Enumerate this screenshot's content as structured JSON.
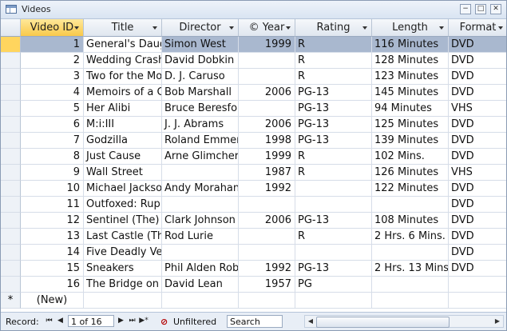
{
  "window": {
    "title": "Videos",
    "min_glyph": "−",
    "restore_glyph": "□",
    "close_glyph": "✕"
  },
  "columns": [
    {
      "label": "Video ID",
      "selected": true
    },
    {
      "label": "Title"
    },
    {
      "label": "Director"
    },
    {
      "label": "© Year"
    },
    {
      "label": "Rating"
    },
    {
      "label": "Length"
    },
    {
      "label": "Format"
    }
  ],
  "rows": [
    [
      "1",
      "General's Daug",
      "Simon West",
      "1999",
      "R",
      "116 Minutes",
      "DVD"
    ],
    [
      "2",
      "Wedding Crash",
      "David Dobkin",
      "",
      "R",
      "128 Minutes",
      "DVD"
    ],
    [
      "3",
      "Two for the Mo",
      "D. J. Caruso",
      "",
      "R",
      "123 Minutes",
      "DVD"
    ],
    [
      "4",
      "Memoirs of a G",
      "Bob Marshall",
      "2006",
      "PG-13",
      "145 Minutes",
      "DVD"
    ],
    [
      "5",
      "Her Alibi",
      "Bruce Beresfor",
      "",
      "PG-13",
      "94 Minutes",
      "VHS"
    ],
    [
      "6",
      "M:i:III",
      "J. J. Abrams",
      "2006",
      "PG-13",
      "125 Minutes",
      "DVD"
    ],
    [
      "7",
      "Godzilla",
      "Roland Emmer",
      "1998",
      "PG-13",
      "139 Minutes",
      "DVD"
    ],
    [
      "8",
      "Just Cause",
      "Arne Glimcher",
      "1999",
      "R",
      "102 Mins.",
      "DVD"
    ],
    [
      "9",
      "Wall Street",
      "",
      "1987",
      "R",
      "126 Minutes",
      "VHS"
    ],
    [
      "10",
      "Michael Jackso",
      "Andy Morahan",
      "1992",
      "",
      "122 Minutes",
      "DVD"
    ],
    [
      "11",
      "Outfoxed: Rup",
      "",
      "",
      "",
      "",
      "DVD"
    ],
    [
      "12",
      "Sentinel (The)",
      "Clark Johnson",
      "2006",
      "PG-13",
      "108 Minutes",
      "DVD"
    ],
    [
      "13",
      "Last Castle (The",
      "Rod Lurie",
      "",
      "R",
      "2 Hrs. 6 Mins.",
      "DVD"
    ],
    [
      "14",
      "Five Deadly Ve",
      "",
      "",
      "",
      "",
      "DVD"
    ],
    [
      "15",
      "Sneakers",
      "Phil Alden Rob",
      "1992",
      "PG-13",
      "2 Hrs. 13 Mins.",
      "DVD"
    ],
    [
      "16",
      "The Bridge on t",
      "David Lean",
      "1957",
      "PG",
      "",
      ""
    ]
  ],
  "new_row": {
    "marker": "*",
    "label": "(New)"
  },
  "status": {
    "record_label": "Record:",
    "record_value": "1 of 16",
    "filter_label": "Unfiltered",
    "search_label": "Search",
    "first": "⏮",
    "prev": "◀",
    "next": "▶",
    "last": "⏭",
    "new": "▶*"
  }
}
